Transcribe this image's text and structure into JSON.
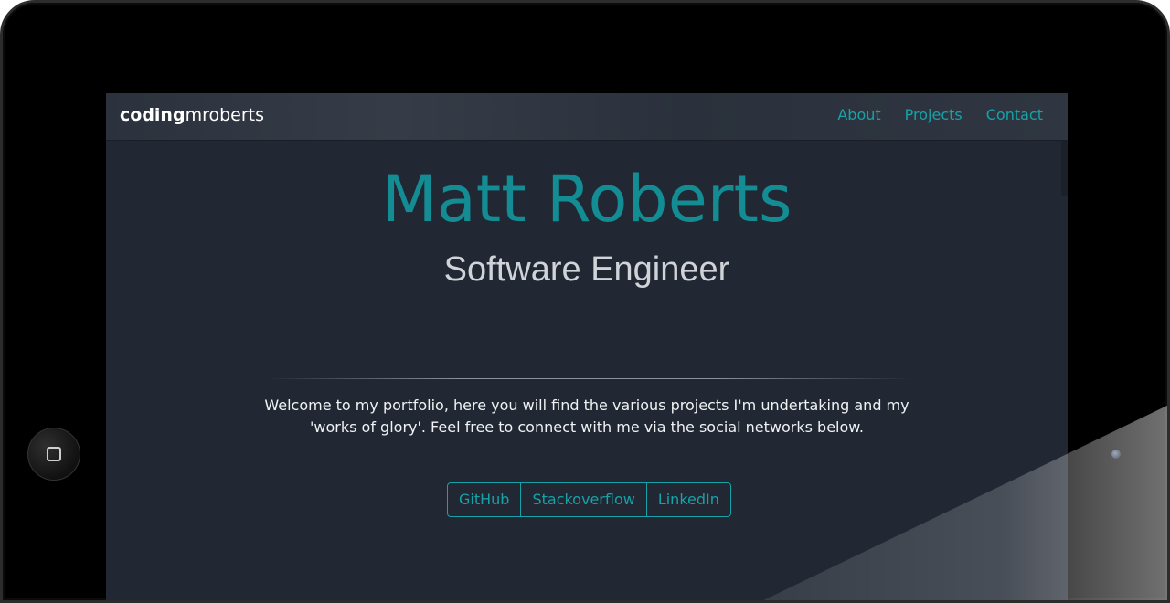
{
  "nav": {
    "brand_bold": "coding",
    "brand_rest": "mroberts",
    "links": [
      "About",
      "Projects",
      "Contact"
    ]
  },
  "hero": {
    "name": "Matt Roberts",
    "role": "Software Engineer"
  },
  "intro": {
    "line1": "Welcome to my portfolio, here you will find the various projects I'm undertaking and my",
    "line2": "'works of glory'. Feel free to connect with me via the social networks below."
  },
  "social": [
    "GitHub",
    "Stackoverflow",
    "LinkedIn"
  ],
  "colors": {
    "accent": "#17a2a8",
    "name": "#138c93",
    "background": "#212833",
    "navbar": "#2f3641"
  },
  "icons": {
    "home_button": "home-square-icon",
    "camera": "camera-icon"
  }
}
